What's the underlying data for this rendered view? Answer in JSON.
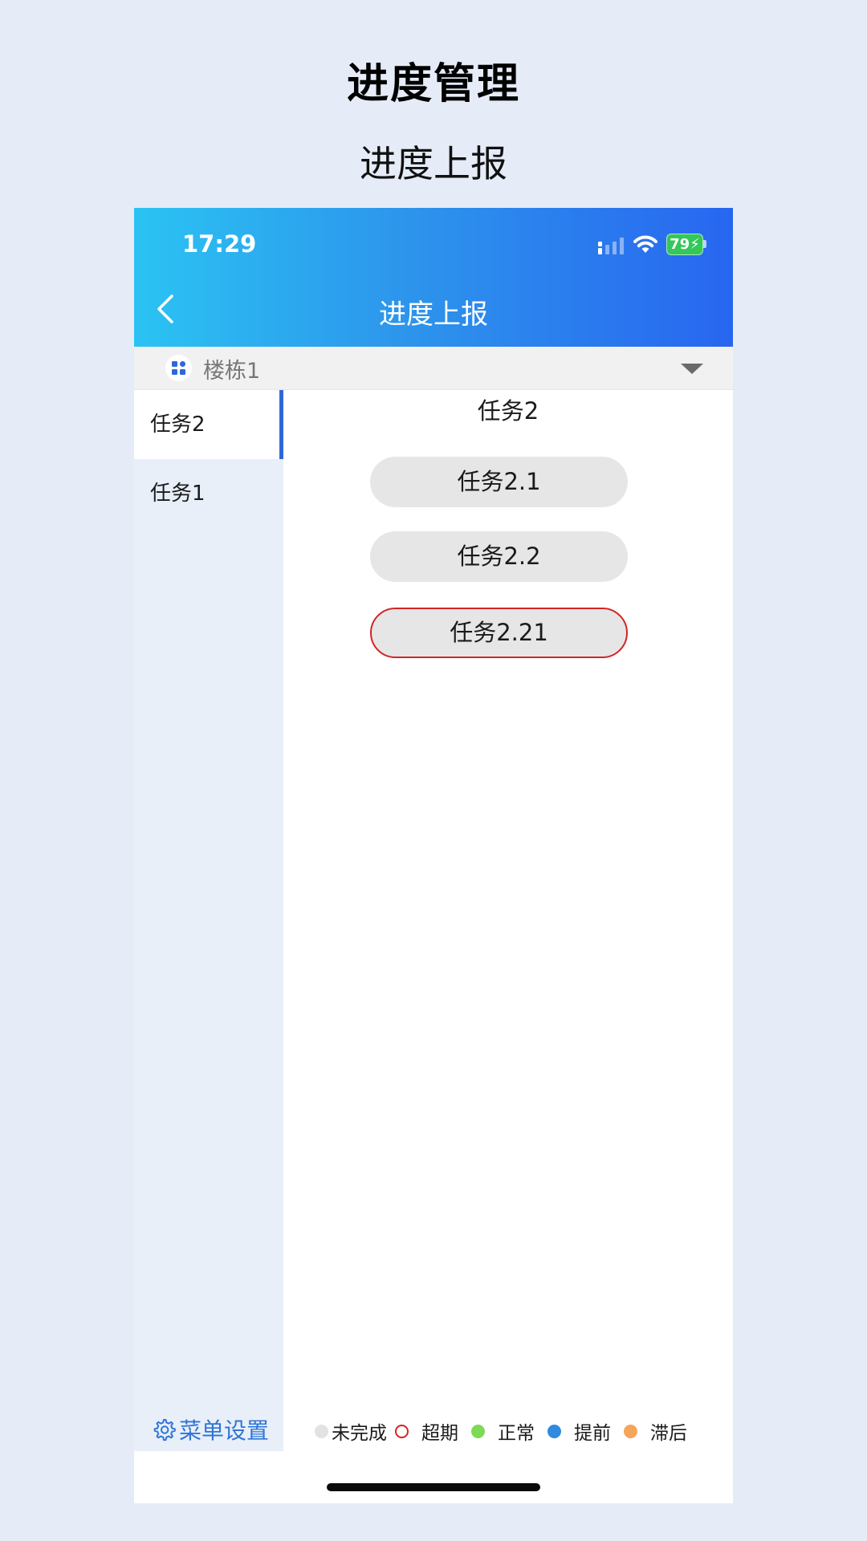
{
  "page": {
    "title": "进度管理",
    "subtitle": "进度上报"
  },
  "status_bar": {
    "time": "17:29",
    "battery": "79"
  },
  "nav": {
    "title": "进度上报",
    "back_icon": "chevron-left-icon"
  },
  "building_selector": {
    "value": "楼栋1",
    "icon": "building-icon"
  },
  "sidebar": {
    "items": [
      {
        "label": "任务2",
        "active": true
      },
      {
        "label": "任务1",
        "active": false
      }
    ],
    "menu_settings_label": "菜单设置"
  },
  "content": {
    "title": "任务2",
    "tasks": [
      {
        "label": "任务2.1",
        "status": "未完成"
      },
      {
        "label": "任务2.2",
        "status": "未完成"
      },
      {
        "label": "任务2.21",
        "status": "超期"
      }
    ]
  },
  "legend": [
    {
      "label": "未完成",
      "color": "#e2e2e2",
      "style": "filled"
    },
    {
      "label": "超期",
      "color": "#d32424",
      "style": "ring"
    },
    {
      "label": "正常",
      "color": "#7ed957",
      "style": "filled"
    },
    {
      "label": "提前",
      "color": "#2f8ae0",
      "style": "filled"
    },
    {
      "label": "滞后",
      "color": "#f5a55a",
      "style": "filled"
    }
  ],
  "colors": {
    "accent": "#2f67d9",
    "header_gradient_start": "#2bc3f3",
    "header_gradient_end": "#2866f0",
    "overdue_border": "#d32424"
  }
}
